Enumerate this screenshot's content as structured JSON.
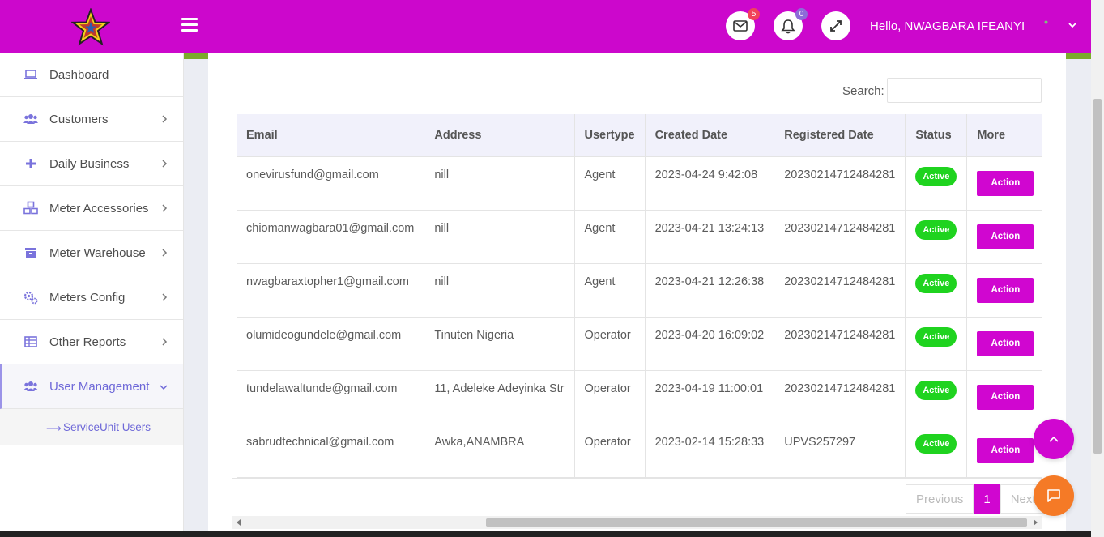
{
  "header": {
    "greeting": "Hello,  NWAGBARA IFEANYI",
    "mail_count": "5",
    "notification_count": "0",
    "bg_color": "#cc07cc"
  },
  "sidebar": {
    "items": [
      {
        "label": "Dashboard",
        "icon": "laptop-icon"
      },
      {
        "label": "Customers",
        "icon": "users-icon"
      },
      {
        "label": "Daily Business",
        "icon": "plus-icon"
      },
      {
        "label": "Meter Accessories",
        "icon": "cubes-icon"
      },
      {
        "label": "Meter Warehouse",
        "icon": "archive-icon"
      },
      {
        "label": "Meters Config",
        "icon": "cogs-icon"
      },
      {
        "label": "Other Reports",
        "icon": "table-icon"
      },
      {
        "label": "User Management",
        "icon": "users-icon"
      }
    ],
    "sub_items": [
      {
        "label": "ServiceUnit Users"
      }
    ]
  },
  "search": {
    "label": "Search:",
    "value": ""
  },
  "table": {
    "columns": [
      "Email",
      "Address",
      "Usertype",
      "Created Date",
      "Registered Date",
      "Status",
      "More"
    ],
    "rows": [
      {
        "email": "onevirusfund@gmail.com",
        "address": "nill",
        "usertype": "Agent",
        "created": "2023-04-24 9:42:08",
        "registered": "20230214712484281",
        "status": "Active",
        "action": "Action"
      },
      {
        "email": "chiomanwagbara01@gmail.com",
        "address": "nill",
        "usertype": "Agent",
        "created": "2023-04-21 13:24:13",
        "registered": "20230214712484281",
        "status": "Active",
        "action": "Action"
      },
      {
        "email": "nwagbaraxtopher1@gmail.com",
        "address": "nill",
        "usertype": "Agent",
        "created": "2023-04-21 12:26:38",
        "registered": "20230214712484281",
        "status": "Active",
        "action": "Action"
      },
      {
        "email": "olumideogundele@gmail.com",
        "address": "Tinuten Nigeria",
        "usertype": "Operator",
        "created": "2023-04-20 16:09:02",
        "registered": "20230214712484281",
        "status": "Active",
        "action": "Action"
      },
      {
        "email": "tundelawaltunde@gmail.com",
        "address": "11, Adeleke Adeyinka Str",
        "usertype": "Operator",
        "created": "2023-04-19 11:00:01",
        "registered": "20230214712484281",
        "status": "Active",
        "action": "Action"
      },
      {
        "email": "sabrudtechnical@gmail.com",
        "address": "Awka,ANAMBRA",
        "usertype": "Operator",
        "created": "2023-02-14 15:28:33",
        "registered": "UPVS257297",
        "status": "Active",
        "action": "Action"
      }
    ]
  },
  "pagination": {
    "previous": "Previous",
    "current": "1",
    "next": "Next"
  },
  "colors": {
    "accent": "#d006d0",
    "active_status": "#1fd31f",
    "chat_button": "#f57a26"
  }
}
